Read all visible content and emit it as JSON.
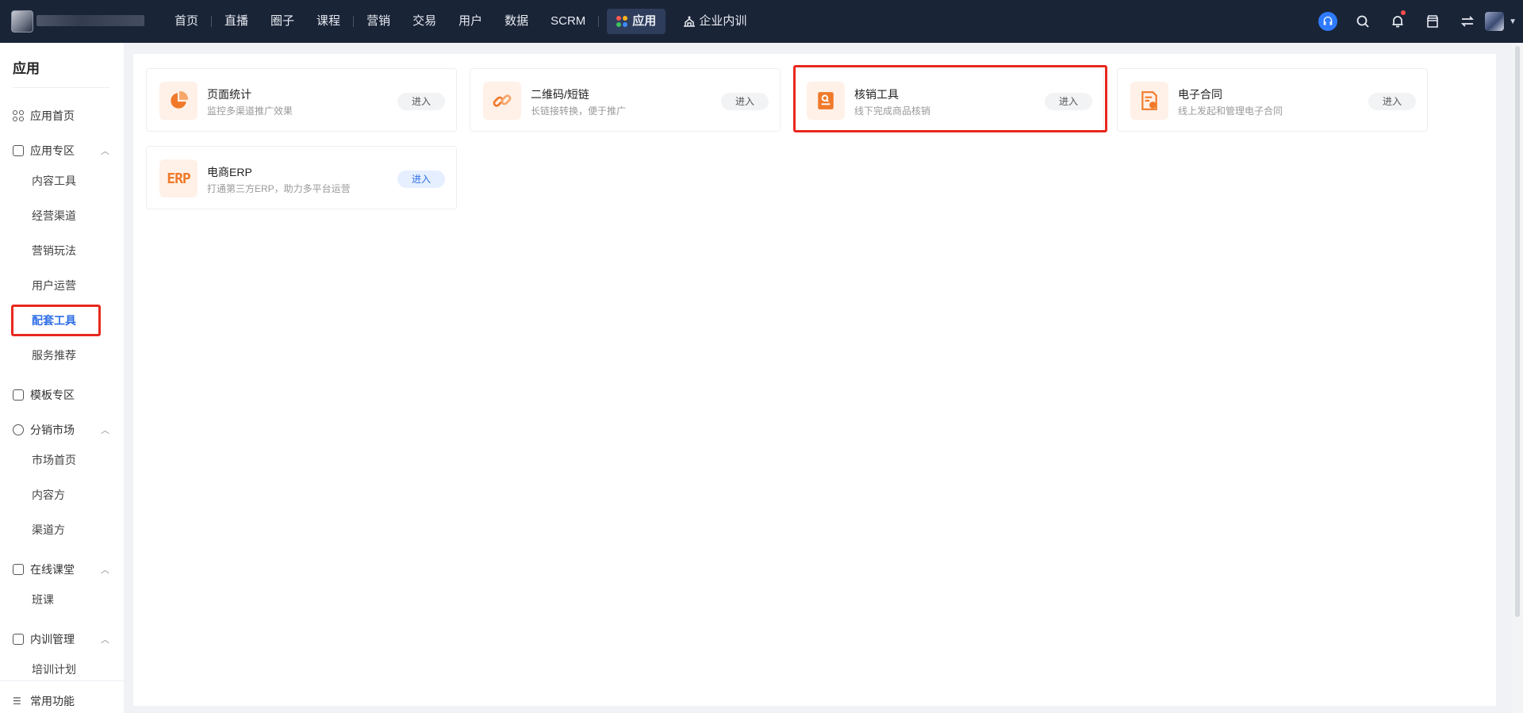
{
  "nav": {
    "items": [
      "首页",
      "直播",
      "圈子",
      "课程",
      "营销",
      "交易",
      "用户",
      "数据",
      "SCRM"
    ],
    "active": "应用",
    "training": "企业内训"
  },
  "top_icons": [
    "support-icon",
    "search-icon",
    "bell-icon",
    "store-icon",
    "switch-icon",
    "avatar"
  ],
  "sidebar": {
    "title": "应用",
    "home": "应用首页",
    "zone": "应用专区",
    "zone_items": [
      "内容工具",
      "经营渠道",
      "营销玩法",
      "用户运营",
      "配套工具",
      "服务推荐"
    ],
    "templates": "模板专区",
    "market": "分销市场",
    "market_items": [
      "市场首页",
      "内容方",
      "渠道方"
    ],
    "online": "在线课堂",
    "online_items": [
      "班课"
    ],
    "training": "内训管理",
    "training_items": [
      "培训计划"
    ],
    "common": "常用功能"
  },
  "cards": [
    {
      "title": "页面统计",
      "desc": "监控多渠道推广效果",
      "enter": "进入"
    },
    {
      "title": "二维码/短链",
      "desc": "长链接转换，便于推广",
      "enter": "进入"
    },
    {
      "title": "核销工具",
      "desc": "线下完成商品核销",
      "enter": "进入"
    },
    {
      "title": "电子合同",
      "desc": "线上发起和管理电子合同",
      "enter": "进入"
    },
    {
      "title": "电商ERP",
      "desc": "打通第三方ERP，助力多平台运营",
      "enter": "进入",
      "icon_text": "ERP"
    }
  ],
  "colors": {
    "topbar": "#1a2437",
    "accent": "#2f6fe6",
    "icon_orange": "#f07a2a",
    "highlight": "#e8281d"
  }
}
